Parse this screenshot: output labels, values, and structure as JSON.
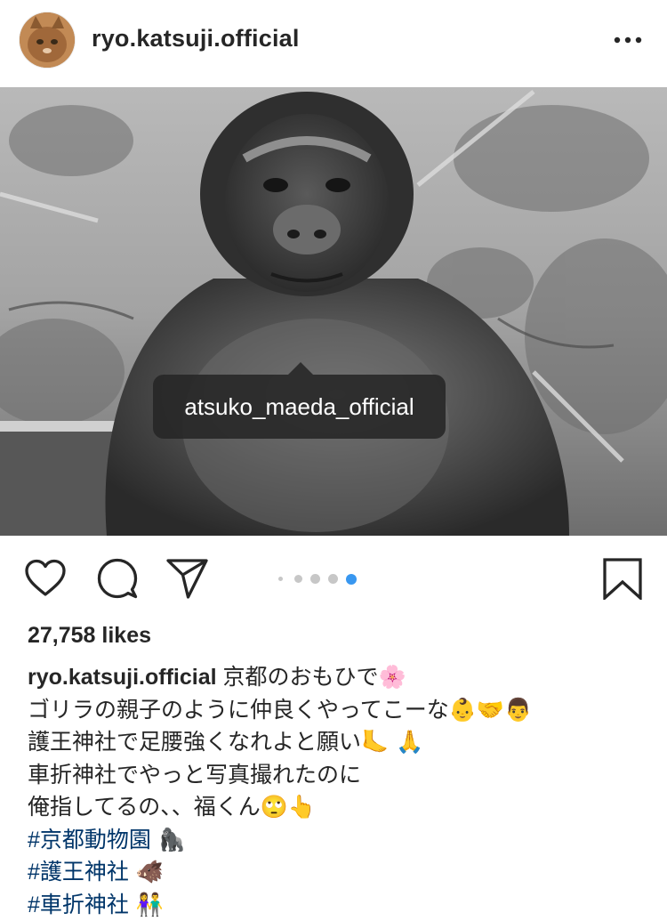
{
  "post": {
    "username": "ryo.katsuji.official",
    "more_icon": "more-horizontal-icon",
    "tagged_user": "atsuko_maeda_official",
    "carousel": {
      "count": 5,
      "active_index": 4
    },
    "likes": "27,758 likes",
    "caption": {
      "owner": "ryo.katsuji.official",
      "lines": [
        {
          "text": " 京都のおもひで",
          "emoji": "🌸"
        },
        {
          "text": "ゴリラの親子のように仲良くやってこーな",
          "emoji": "👶🤝👨"
        },
        {
          "text": "護王神社で足腰強くなれよと願い",
          "emoji": "🦶 🙏"
        },
        {
          "text": "車折神社でやっと写真撮れたのに",
          "emoji": ""
        },
        {
          "text": "俺指してるの、、福くん",
          "emoji": "🙄👆"
        }
      ],
      "hashtags": [
        {
          "tag": "#京都動物園",
          "emoji": " 🦍"
        },
        {
          "tag": "#護王神社",
          "emoji": " 🐗"
        },
        {
          "tag": "#車折神社",
          "emoji": " 👫"
        }
      ]
    }
  },
  "icons": {
    "like": "heart-icon",
    "comment": "comment-icon",
    "share": "paper-plane-icon",
    "save": "bookmark-icon",
    "user_tag": "person-icon"
  },
  "colors": {
    "hashtag": "#003569",
    "carousel_active": "#3897f0",
    "text": "#262626"
  }
}
